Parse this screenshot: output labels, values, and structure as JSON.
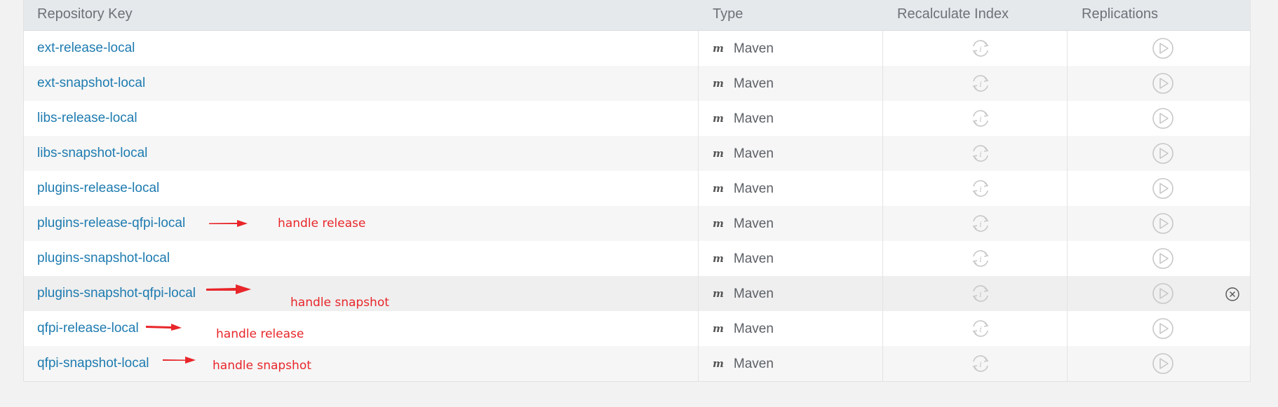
{
  "table": {
    "headers": {
      "key": "Repository Key",
      "type": "Type",
      "recalc": "Recalculate Index",
      "replications": "Replications"
    },
    "rows": [
      {
        "key": "ext-release-local",
        "type": "Maven"
      },
      {
        "key": "ext-snapshot-local",
        "type": "Maven"
      },
      {
        "key": "libs-release-local",
        "type": "Maven"
      },
      {
        "key": "libs-snapshot-local",
        "type": "Maven"
      },
      {
        "key": "plugins-release-local",
        "type": "Maven"
      },
      {
        "key": "plugins-release-qfpi-local",
        "type": "Maven",
        "note": "handle release"
      },
      {
        "key": "plugins-snapshot-local",
        "type": "Maven"
      },
      {
        "key": "plugins-snapshot-qfpi-local",
        "type": "Maven",
        "note": "handle snapshot"
      },
      {
        "key": "qfpi-release-local",
        "type": "Maven",
        "note": "handle release"
      },
      {
        "key": "qfpi-snapshot-local",
        "type": "Maven",
        "note": "handle snapshot"
      }
    ],
    "type_icon_letter": "m"
  },
  "icons": {
    "recalc": "recalculate-index-icon",
    "replicate": "replication-play-icon",
    "delete": "delete-circle-x-icon",
    "annotation_arrow": "red-arrow-icon"
  },
  "colors": {
    "link": "#1e7bb0",
    "annotation": "#e8262a",
    "header_bg": "#e6e9ec"
  }
}
